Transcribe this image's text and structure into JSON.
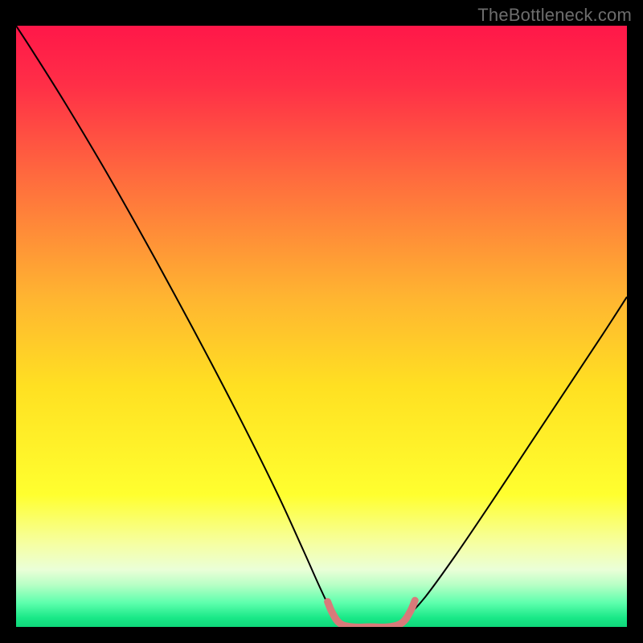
{
  "watermark": "TheBottleneck.com",
  "chart_data": {
    "type": "line",
    "title": "",
    "xlabel": "",
    "ylabel": "",
    "x_range": [
      0,
      100
    ],
    "y_range": [
      0,
      100
    ],
    "gradient_stops": [
      {
        "offset": 0.0,
        "color": "#ff1749"
      },
      {
        "offset": 0.1,
        "color": "#ff2f47"
      },
      {
        "offset": 0.25,
        "color": "#ff6a3e"
      },
      {
        "offset": 0.45,
        "color": "#ffb431"
      },
      {
        "offset": 0.6,
        "color": "#ffe022"
      },
      {
        "offset": 0.78,
        "color": "#ffff2f"
      },
      {
        "offset": 0.86,
        "color": "#f6ffa0"
      },
      {
        "offset": 0.905,
        "color": "#eaffd8"
      },
      {
        "offset": 0.93,
        "color": "#b7ffc5"
      },
      {
        "offset": 0.96,
        "color": "#5dffad"
      },
      {
        "offset": 0.985,
        "color": "#19e887"
      },
      {
        "offset": 1.0,
        "color": "#0fd67a"
      }
    ],
    "series": [
      {
        "name": "bottleneck-curve",
        "stroke": "#000000",
        "stroke_width": 2.0,
        "points": [
          {
            "x": 0.0,
            "y": 100.0
          },
          {
            "x": 3.0,
            "y": 95.3
          },
          {
            "x": 8.0,
            "y": 87.2
          },
          {
            "x": 14.0,
            "y": 77.0
          },
          {
            "x": 20.0,
            "y": 66.3
          },
          {
            "x": 26.0,
            "y": 55.2
          },
          {
            "x": 32.0,
            "y": 43.8
          },
          {
            "x": 38.0,
            "y": 32.0
          },
          {
            "x": 43.0,
            "y": 21.7
          },
          {
            "x": 47.0,
            "y": 12.8
          },
          {
            "x": 50.0,
            "y": 6.0
          },
          {
            "x": 52.0,
            "y": 2.0
          },
          {
            "x": 54.0,
            "y": 0.0
          },
          {
            "x": 62.0,
            "y": 0.0
          },
          {
            "x": 64.0,
            "y": 1.7
          },
          {
            "x": 67.0,
            "y": 5.0
          },
          {
            "x": 72.0,
            "y": 12.0
          },
          {
            "x": 78.0,
            "y": 21.0
          },
          {
            "x": 84.0,
            "y": 30.2
          },
          {
            "x": 90.0,
            "y": 39.4
          },
          {
            "x": 96.0,
            "y": 48.6
          },
          {
            "x": 100.0,
            "y": 54.9
          }
        ]
      },
      {
        "name": "bottom-marker",
        "stroke": "#d87a7a",
        "stroke_width": 9.0,
        "linecap": "round",
        "points": [
          {
            "x": 51.0,
            "y": 4.2
          },
          {
            "x": 51.8,
            "y": 2.3
          },
          {
            "x": 53.0,
            "y": 0.6
          },
          {
            "x": 55.0,
            "y": 0.0
          },
          {
            "x": 58.0,
            "y": 0.0
          },
          {
            "x": 61.0,
            "y": 0.0
          },
          {
            "x": 63.2,
            "y": 0.7
          },
          {
            "x": 64.5,
            "y": 2.5
          },
          {
            "x": 65.3,
            "y": 4.4
          }
        ]
      }
    ]
  }
}
